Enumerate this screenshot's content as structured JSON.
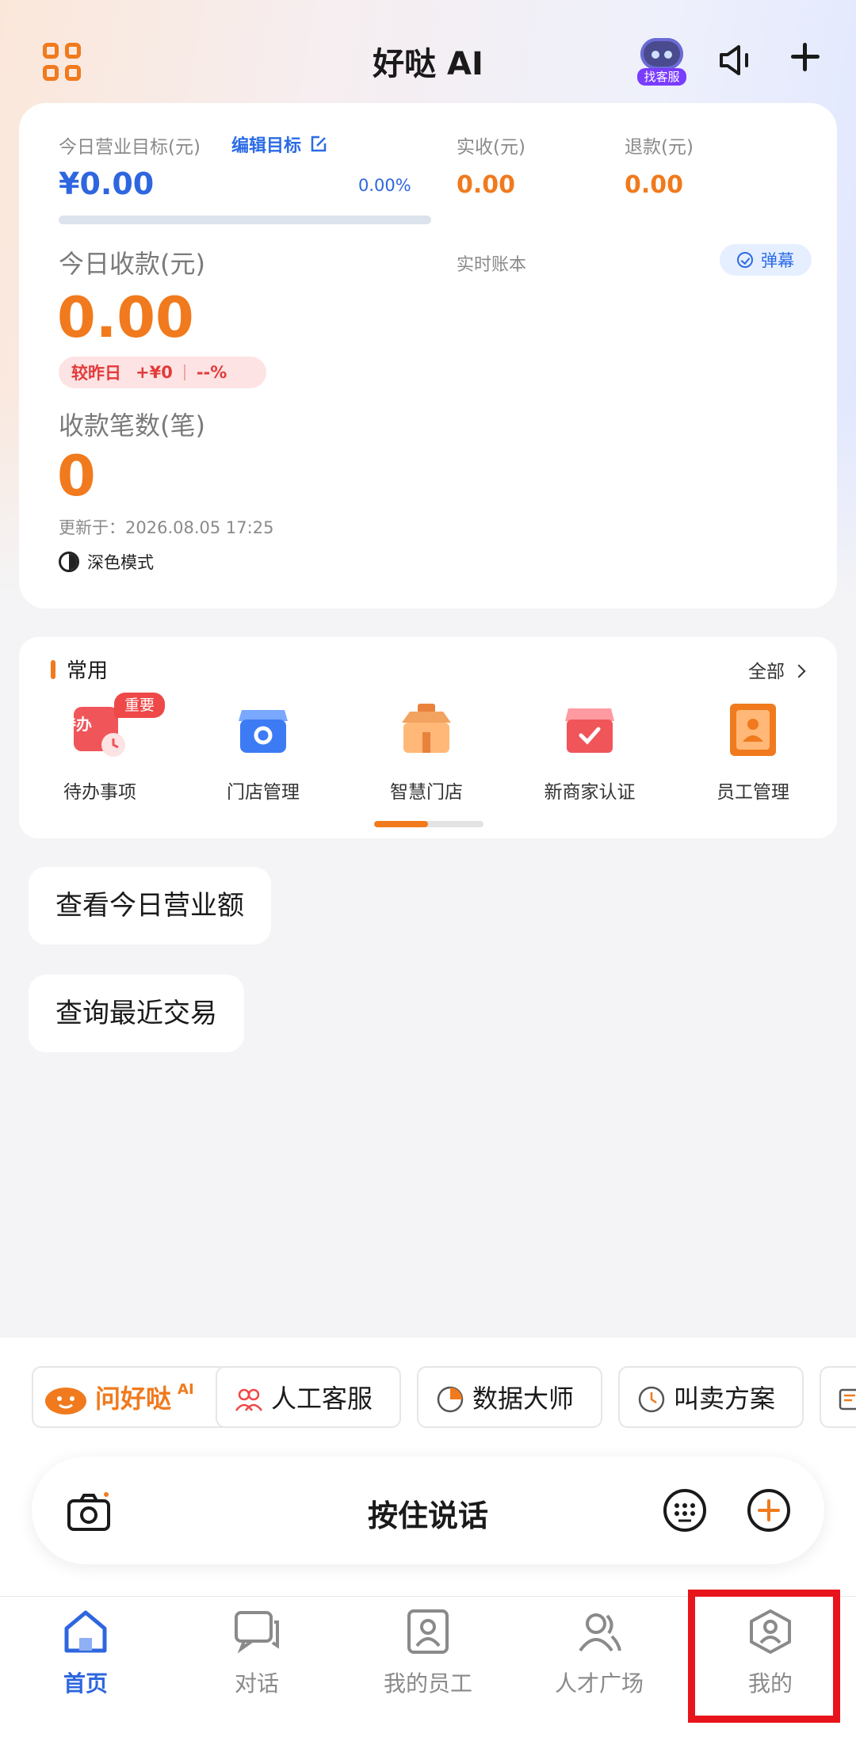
{
  "header": {
    "title": "好哒 AI",
    "bot_tag": "找客服"
  },
  "summary": {
    "target_label": "今日营业目标(元)",
    "edit_target": "编辑目标",
    "target_value": "¥0.00",
    "target_percent": "0.00%",
    "target_progress": 0,
    "received_label": "实收(元)",
    "received_value": "0.00",
    "refund_label": "退款(元)",
    "refund_value": "0.00",
    "today_income_label": "今日收款(元)",
    "today_income_value": "0.00",
    "ledger_label": "实时账本",
    "danmu_label": "弹幕",
    "compare_label": "较昨日",
    "compare_amount": "+¥0",
    "compare_percent": "--%",
    "count_label": "收款笔数(笔)",
    "count_value": "0",
    "updated_at": "更新于：2026.08.05 17:25",
    "dark_mode_label": "深色模式"
  },
  "common": {
    "title": "常用",
    "all_label": "全部",
    "tools": [
      {
        "name": "待办事项",
        "icon": "todo-icon",
        "badge": "重要",
        "icon_text": "待办"
      },
      {
        "name": "门店管理",
        "icon": "store-management-icon"
      },
      {
        "name": "智慧门店",
        "icon": "smart-store-icon"
      },
      {
        "name": "新商家认证",
        "icon": "merchant-verify-icon"
      },
      {
        "name": "员工管理",
        "icon": "staff-management-icon"
      }
    ]
  },
  "queries": [
    {
      "text": "查看今日营业额"
    },
    {
      "text": "查询最近交易"
    }
  ],
  "chips": [
    {
      "label": "问好哒",
      "icon": "haoda-mascot-icon",
      "sup": "AI"
    },
    {
      "label": "人工客服",
      "icon": "customer-service-icon"
    },
    {
      "label": "数据大师",
      "icon": "pie-chart-icon"
    },
    {
      "label": "叫卖方案",
      "icon": "clock-icon"
    }
  ],
  "input": {
    "hold_to_talk": "按住说话"
  },
  "tabs": [
    {
      "label": "首页",
      "icon": "home-icon",
      "active": true
    },
    {
      "label": "对话",
      "icon": "chat-icon"
    },
    {
      "label": "我的员工",
      "icon": "employee-icon"
    },
    {
      "label": "人才广场",
      "icon": "talent-icon"
    },
    {
      "label": "我的",
      "icon": "profile-icon"
    }
  ],
  "colors": {
    "accent": "#f07a1d",
    "primary": "#2e66df",
    "highlight": "#e8141b"
  }
}
